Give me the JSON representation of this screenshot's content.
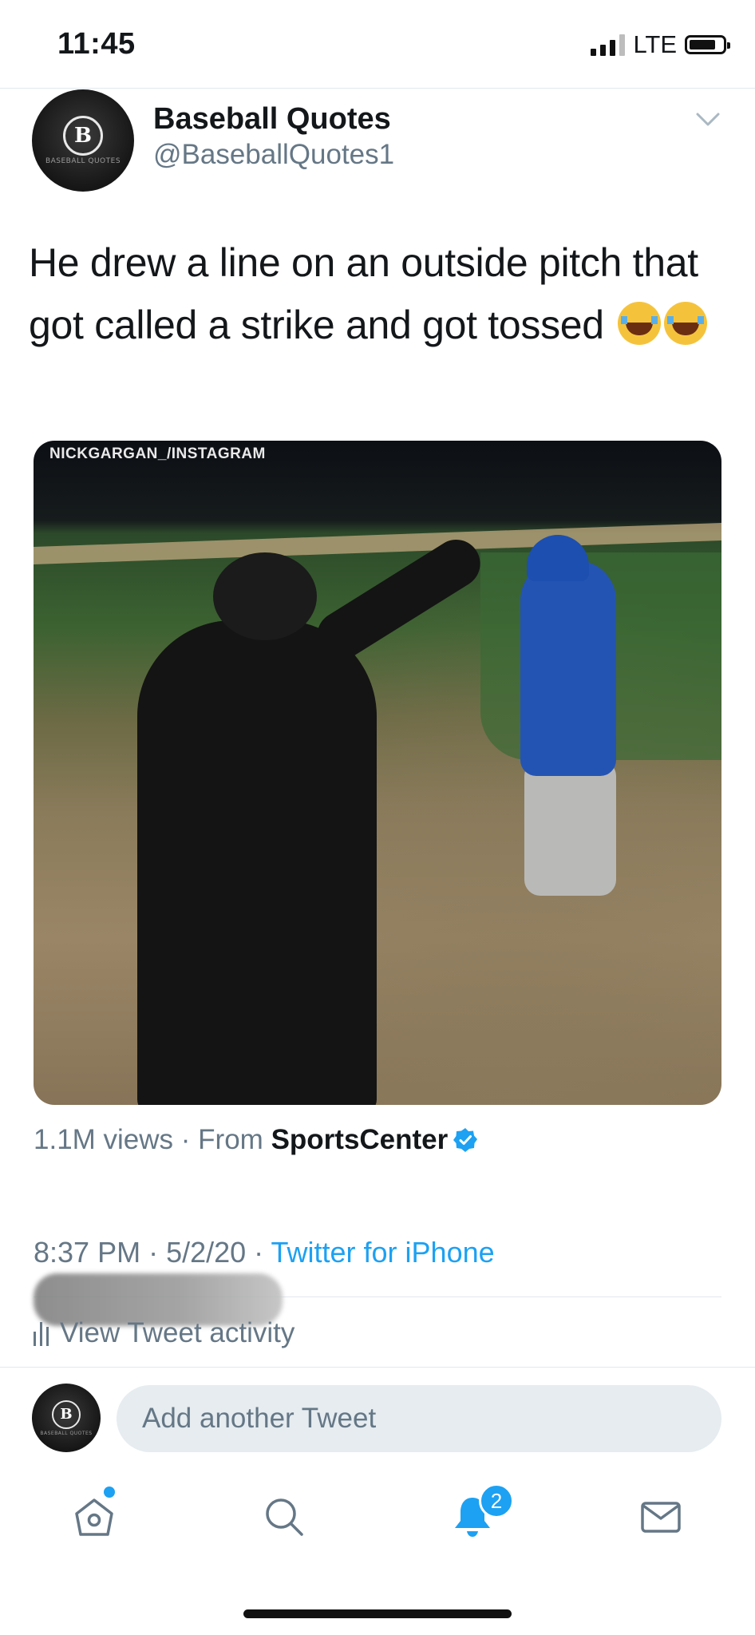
{
  "status_bar": {
    "time": "11:45",
    "network": "LTE"
  },
  "tweet": {
    "display_name": "Baseball Quotes",
    "handle": "@BaseballQuotes1",
    "avatar_letter": "B",
    "avatar_caption": "BASEBALL QUOTES",
    "text": "He drew a line on an outside pitch that got called a strike and got tossed",
    "emoji": [
      "face-with-tears-of-joy",
      "face-with-tears-of-joy"
    ],
    "media": {
      "credit": "NICKGARGAN_/INSTAGRAM",
      "views": "1.1M views",
      "from_label": "From",
      "source": "SportsCenter"
    },
    "time": "8:37 PM",
    "date": "5/2/20",
    "client": "Twitter for iPhone",
    "activity_label": "View Tweet activity"
  },
  "reply": {
    "placeholder": "Add another Tweet"
  },
  "tab_bar": {
    "items": [
      "home-icon",
      "search-icon",
      "notifications-icon",
      "messages-icon"
    ],
    "notification_count": "2"
  },
  "colors": {
    "accent": "#1da1f2",
    "secondary_text": "#657786",
    "input_bg": "#e6ecf0"
  }
}
